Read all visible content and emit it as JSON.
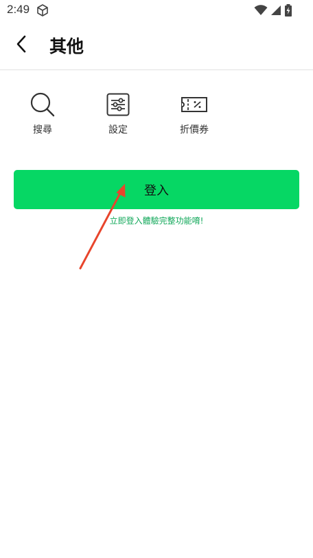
{
  "status_bar": {
    "time": "2:49",
    "icons": [
      "cube-icon",
      "wifi-icon",
      "signal-icon",
      "battery-charging-icon"
    ]
  },
  "header": {
    "title": "其他",
    "back_icon": "chevron-left-icon"
  },
  "shortcuts": [
    {
      "label": "搜尋",
      "icon": "search-icon"
    },
    {
      "label": "設定",
      "icon": "sliders-icon"
    },
    {
      "label": "折價券",
      "icon": "coupon-icon"
    }
  ],
  "login": {
    "button_label": "登入",
    "hint": "立即登入體驗完整功能唷!"
  },
  "colors": {
    "accent": "#06d764",
    "hint_text": "#12a85a",
    "annotation_arrow": "#e8452c"
  }
}
